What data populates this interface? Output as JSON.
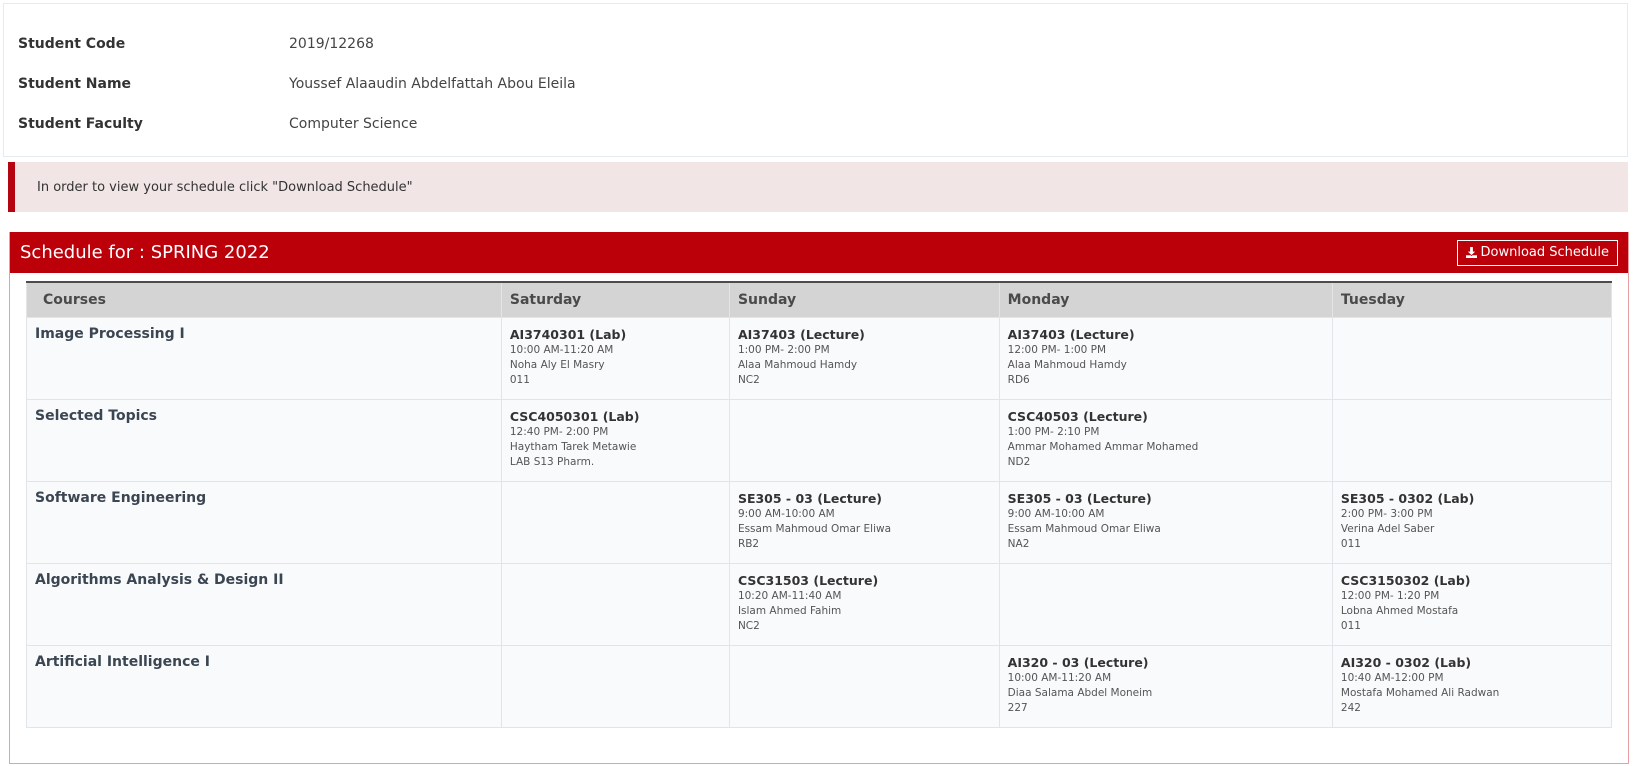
{
  "student": {
    "code_label": "Student Code",
    "code_value": "2019/12268",
    "name_label": "Student Name",
    "name_value": "Youssef Alaaudin Abdelfattah Abou Eleila",
    "faculty_label": "Student Faculty",
    "faculty_value": "Computer Science"
  },
  "alert": {
    "text": "In order to view your schedule click \"Download Schedule\""
  },
  "schedule": {
    "title": "Schedule for : SPRING 2022",
    "download_label": "Download Schedule",
    "download_icon": "download-icon",
    "headers": [
      "Courses",
      "Saturday",
      "Sunday",
      "Monday",
      "Tuesday"
    ],
    "rows": [
      {
        "course": "Image Processing I",
        "cells": [
          {
            "code": "AI3740301 (Lab)",
            "time": "10:00 AM-11:20 AM",
            "instructor": "Noha Aly El Masry",
            "room": "011"
          },
          {
            "code": "AI37403 (Lecture)",
            "time": "1:00 PM- 2:00 PM",
            "instructor": "Alaa Mahmoud Hamdy",
            "room": "NC2"
          },
          {
            "code": "AI37403 (Lecture)",
            "time": "12:00 PM- 1:00 PM",
            "instructor": "Alaa Mahmoud Hamdy",
            "room": "RD6"
          },
          {
            "code": "",
            "time": "",
            "instructor": "",
            "room": ""
          }
        ]
      },
      {
        "course": "Selected Topics",
        "cells": [
          {
            "code": "CSC4050301 (Lab)",
            "time": "12:40 PM- 2:00 PM",
            "instructor": "Haytham Tarek Metawie",
            "room": "LAB S13 Pharm."
          },
          {
            "code": "",
            "time": "",
            "instructor": "",
            "room": ""
          },
          {
            "code": "CSC40503 (Lecture)",
            "time": "1:00 PM- 2:10 PM",
            "instructor": "Ammar Mohamed Ammar Mohamed",
            "room": "ND2"
          },
          {
            "code": "",
            "time": "",
            "instructor": "",
            "room": ""
          }
        ]
      },
      {
        "course": "Software Engineering",
        "cells": [
          {
            "code": "",
            "time": "",
            "instructor": "",
            "room": ""
          },
          {
            "code": "SE305 - 03 (Lecture)",
            "time": "9:00 AM-10:00 AM",
            "instructor": "Essam Mahmoud Omar Eliwa",
            "room": "RB2"
          },
          {
            "code": "SE305 - 03 (Lecture)",
            "time": "9:00 AM-10:00 AM",
            "instructor": "Essam Mahmoud Omar Eliwa",
            "room": "NA2"
          },
          {
            "code": "SE305 - 0302 (Lab)",
            "time": "2:00 PM- 3:00 PM",
            "instructor": "Verina Adel Saber",
            "room": "011"
          }
        ]
      },
      {
        "course": "Algorithms Analysis & Design II",
        "cells": [
          {
            "code": "",
            "time": "",
            "instructor": "",
            "room": ""
          },
          {
            "code": "CSC31503 (Lecture)",
            "time": "10:20 AM-11:40 AM",
            "instructor": "Islam Ahmed Fahim",
            "room": "NC2"
          },
          {
            "code": "",
            "time": "",
            "instructor": "",
            "room": ""
          },
          {
            "code": "CSC3150302 (Lab)",
            "time": "12:00 PM- 1:20 PM",
            "instructor": "Lobna Ahmed Mostafa",
            "room": "011"
          }
        ]
      },
      {
        "course": "Artificial Intelligence I",
        "cells": [
          {
            "code": "",
            "time": "",
            "instructor": "",
            "room": ""
          },
          {
            "code": "",
            "time": "",
            "instructor": "",
            "room": ""
          },
          {
            "code": "AI320 - 03 (Lecture)",
            "time": "10:00 AM-11:20 AM",
            "instructor": "Diaa Salama Abdel Moneim",
            "room": "227"
          },
          {
            "code": "AI320 - 0302 (Lab)",
            "time": "10:40 AM-12:00 PM",
            "instructor": "Mostafa Mohamed Ali Radwan",
            "room": "242"
          }
        ]
      }
    ]
  },
  "colors": {
    "accent": "#bb000a",
    "alert_bg": "#f1e5e5",
    "header_bg": "#d4d4d4"
  }
}
